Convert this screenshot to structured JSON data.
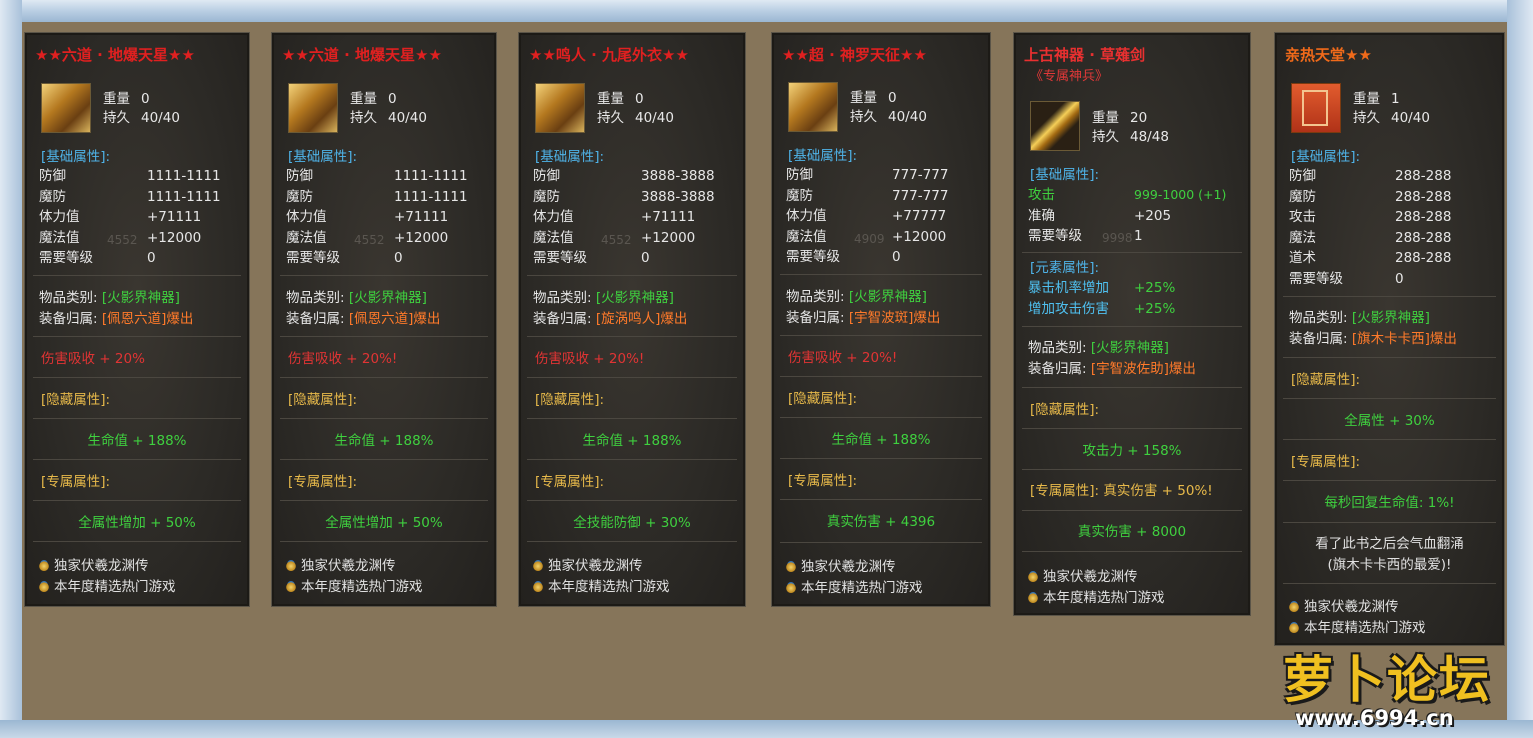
{
  "cards": [
    {
      "title": "★★六道 · 地爆天星★★",
      "weight_label": "重量",
      "weight": "0",
      "dur_label": "持久",
      "dur": "40/40",
      "base_header": "[基础属性]:",
      "stats": [
        {
          "k": "防御",
          "v": "1111-1111"
        },
        {
          "k": "魔防",
          "v": "1111-1111"
        },
        {
          "k": "体力值",
          "v": "+71111"
        },
        {
          "k": "魔法值",
          "v": "+12000"
        },
        {
          "k": "需要等级",
          "v": "0"
        }
      ],
      "ghost": "4552",
      "cat_label": "物品类别:",
      "cat_value": "[火影界神器]",
      "owner_label": "装备归属:",
      "owner_value": "[佩恩六道]爆出",
      "red_line": "伤害吸收 + 20%",
      "hidden_header": "[隐藏属性]:",
      "hidden_value": "生命值 + 188%",
      "excl_header": "[专属属性]:",
      "excl_value": "全属性增加 + 50%",
      "ad1": "独家伏羲龙渊传",
      "ad2": "本年度精选热门游戏"
    },
    {
      "title": "★★六道 · 地爆天星★★",
      "weight_label": "重量",
      "weight": "0",
      "dur_label": "持久",
      "dur": "40/40",
      "base_header": "[基础属性]:",
      "stats": [
        {
          "k": "防御",
          "v": "1111-1111"
        },
        {
          "k": "魔防",
          "v": "1111-1111"
        },
        {
          "k": "体力值",
          "v": "+71111"
        },
        {
          "k": "魔法值",
          "v": "+12000"
        },
        {
          "k": "需要等级",
          "v": "0"
        }
      ],
      "ghost": "4552",
      "cat_label": "物品类别:",
      "cat_value": "[火影界神器]",
      "owner_label": "装备归属:",
      "owner_value": "[佩恩六道]爆出",
      "red_line": "伤害吸收 + 20%!",
      "hidden_header": "[隐藏属性]:",
      "hidden_value": "生命值 + 188%",
      "excl_header": "[专属属性]:",
      "excl_value": "全属性增加 + 50%",
      "ad1": "独家伏羲龙渊传",
      "ad2": "本年度精选热门游戏"
    },
    {
      "title": "★★鸣人 · 九尾外衣★★",
      "weight_label": "重量",
      "weight": "0",
      "dur_label": "持久",
      "dur": "40/40",
      "base_header": "[基础属性]:",
      "stats": [
        {
          "k": "防御",
          "v": "3888-3888"
        },
        {
          "k": "魔防",
          "v": "3888-3888"
        },
        {
          "k": "体力值",
          "v": "+71111"
        },
        {
          "k": "魔法值",
          "v": "+12000"
        },
        {
          "k": "需要等级",
          "v": "0"
        }
      ],
      "ghost": "4552",
      "cat_label": "物品类别:",
      "cat_value": "[火影界神器]",
      "owner_label": "装备归属:",
      "owner_value": "[旋涡鸣人]爆出",
      "red_line": "伤害吸收 + 20%!",
      "hidden_header": "[隐藏属性]:",
      "hidden_value": "生命值 + 188%",
      "excl_header": "[专属属性]:",
      "excl_value": "全技能防御 + 30%",
      "ad1": "独家伏羲龙渊传",
      "ad2": "本年度精选热门游戏"
    },
    {
      "title": "★★超 · 神罗天征★★",
      "weight_label": "重量",
      "weight": "0",
      "dur_label": "持久",
      "dur": "40/40",
      "base_header": "[基础属性]:",
      "stats": [
        {
          "k": "防御",
          "v": "777-777"
        },
        {
          "k": "魔防",
          "v": "777-777"
        },
        {
          "k": "体力值",
          "v": "+77777"
        },
        {
          "k": "魔法值",
          "v": "+12000"
        },
        {
          "k": "需要等级",
          "v": "0"
        }
      ],
      "ghost": "4909",
      "cat_label": "物品类别:",
      "cat_value": "[火影界神器]",
      "owner_label": "装备归属:",
      "owner_value": "[宇智波斑]爆出",
      "red_line": "伤害吸收 + 20%!",
      "hidden_header": "[隐藏属性]:",
      "hidden_value": "生命值 + 188%",
      "excl_header": "[专属属性]:",
      "excl_value": "真实伤害 + 4396",
      "ad1": "独家伏羲龙渊传",
      "ad2": "本年度精选热门游戏"
    },
    {
      "title": "上古神器 · 草薙剑",
      "subtitle": "《专属神兵》",
      "weight_label": "重量",
      "weight": "20",
      "dur_label": "持久",
      "dur": "48/48",
      "base_header": "[基础属性]:",
      "stats": [
        {
          "k": "攻击",
          "v": "999-1000 (+1)"
        },
        {
          "k": "准确",
          "v": "+205"
        },
        {
          "k": "需要等级",
          "v": "1"
        }
      ],
      "ghost": "9998",
      "elem_header": "[元素属性]:",
      "elem": [
        {
          "k": "暴击机率增加",
          "v": "+25%"
        },
        {
          "k": "增加攻击伤害",
          "v": "+25%"
        }
      ],
      "cat_label": "物品类别:",
      "cat_value": "[火影界神器]",
      "owner_label": "装备归属:",
      "owner_value": "[宇智波佐助]爆出",
      "hidden_header": "[隐藏属性]:",
      "hidden_value": "攻击力 + 158%",
      "excl_header": "[专属属性]: 真实伤害 + 50%!",
      "excl_value": "真实伤害 + 8000",
      "ad1": "独家伏羲龙渊传",
      "ad2": "本年度精选热门游戏"
    },
    {
      "title": "亲热天堂★★",
      "weight_label": "重量",
      "weight": "1",
      "dur_label": "持久",
      "dur": "40/40",
      "base_header": "[基础属性]:",
      "stats": [
        {
          "k": "防御",
          "v": "288-288"
        },
        {
          "k": "魔防",
          "v": "288-288"
        },
        {
          "k": "攻击",
          "v": "288-288"
        },
        {
          "k": "魔法",
          "v": "288-288"
        },
        {
          "k": "道术",
          "v": "288-288"
        },
        {
          "k": "需要等级",
          "v": "0"
        }
      ],
      "cat_label": "物品类别:",
      "cat_value": "[火影界神器]",
      "owner_label": "装备归属:",
      "owner_value": "[旗木卡卡西]爆出",
      "hidden_header": "[隐藏属性]:",
      "hidden_value": "全属性 + 30%",
      "excl_header": "[专属属性]:",
      "excl_value": "每秒回复生命值: 1%!",
      "desc1": "看了此书之后会气血翻涌",
      "desc2": "(旗木卡卡西的最爱)!",
      "ad1": "独家伏羲龙渊传",
      "ad2": "本年度精选热门游戏"
    }
  ],
  "watermark": {
    "brand": "萝卜论坛",
    "url": "www.6994.cn"
  },
  "colors": {
    "title_red": "#e02020",
    "section_blue": "#4fb3e8",
    "green": "#3fd03f",
    "orange": "#ff7a2a",
    "gold": "#e7b94a"
  }
}
